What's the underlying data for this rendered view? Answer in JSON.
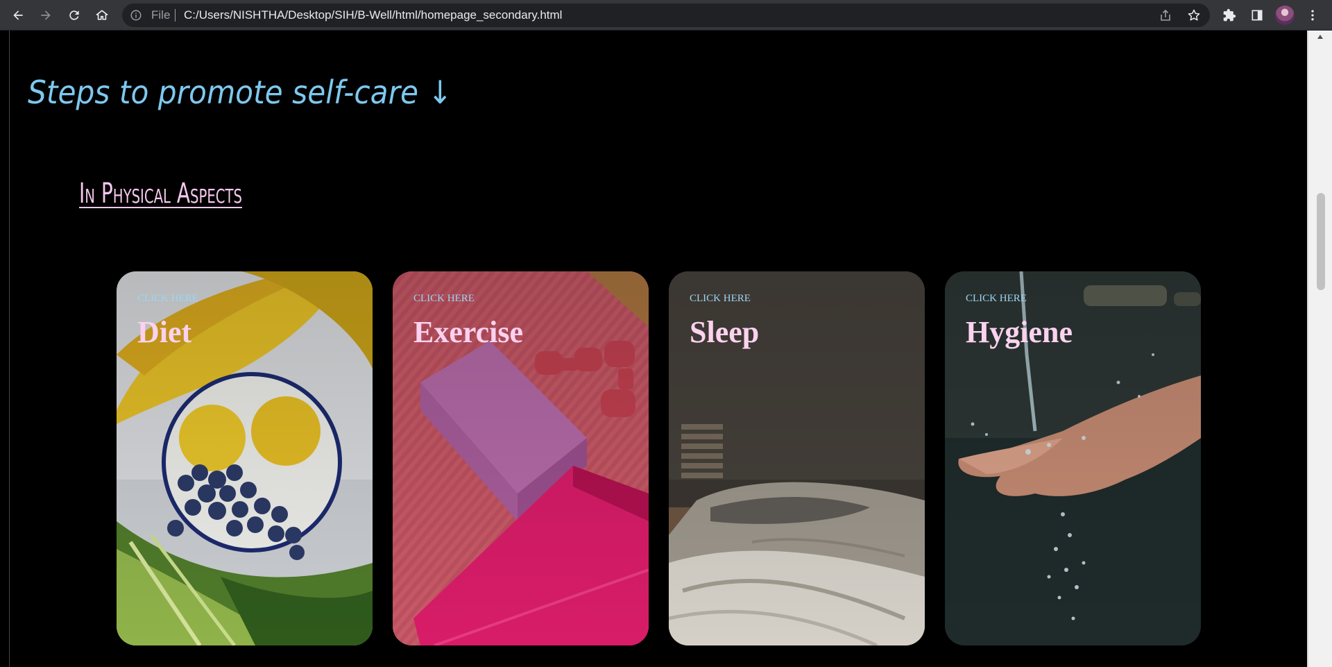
{
  "browser": {
    "url_chip": "File",
    "url": "C:/Users/NISHTHA/Desktop/SIH/B-Well/html/homepage_secondary.html",
    "icons": [
      "back-icon",
      "forward-icon",
      "reload-icon",
      "home-icon",
      "info-icon",
      "share-icon",
      "star-icon",
      "extensions-icon",
      "sidepanel-icon",
      "profile-avatar",
      "menu-icon"
    ]
  },
  "page": {
    "heading": "Steps to promote self-care ↓",
    "subheading": "In Physical Aspects",
    "cards": [
      {
        "cta": "CLICK HERE",
        "title": "Diet"
      },
      {
        "cta": "CLICK HERE",
        "title": "Exercise"
      },
      {
        "cta": "CLICK HERE",
        "title": "Sleep"
      },
      {
        "cta": "CLICK HERE",
        "title": "Hygiene"
      }
    ]
  },
  "colors": {
    "page_bg": "#000000",
    "heading": "#7ec8ee",
    "subheading": "#f6c8ee",
    "card_cta": "#9fd5f2",
    "card_title": "#fbd2ef"
  }
}
